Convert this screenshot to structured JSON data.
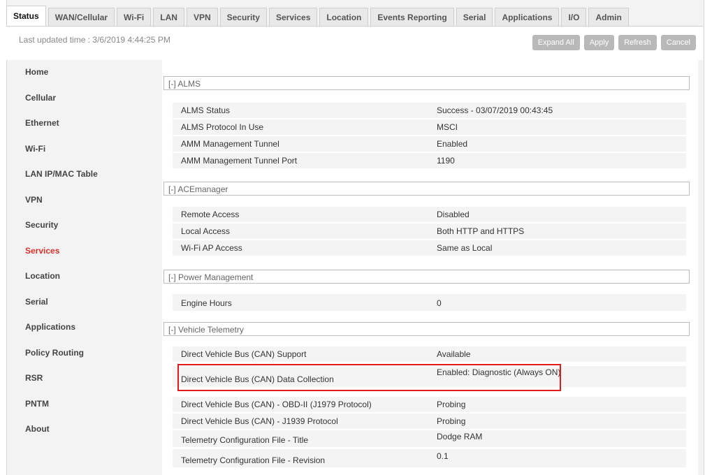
{
  "tabs": [
    "Status",
    "WAN/Cellular",
    "Wi-Fi",
    "LAN",
    "VPN",
    "Security",
    "Services",
    "Location",
    "Events Reporting",
    "Serial",
    "Applications",
    "I/O",
    "Admin"
  ],
  "active_tab": "Status",
  "last_updated": "Last updated time : 3/6/2019 4:44:25 PM",
  "buttons": {
    "expand_all": "Expand All",
    "apply": "Apply",
    "refresh": "Refresh",
    "cancel": "Cancel"
  },
  "sidebar": {
    "items": [
      "Home",
      "Cellular",
      "Ethernet",
      "Wi-Fi",
      "LAN IP/MAC Table",
      "VPN",
      "Security",
      "Services",
      "Location",
      "Serial",
      "Applications",
      "Policy Routing",
      "RSR",
      "PNTM",
      "About"
    ],
    "active": "Services"
  },
  "sections": [
    {
      "header": "[-] ALMS",
      "rows": [
        {
          "label": "ALMS Status",
          "value": "Success - 03/07/2019 00:43:45"
        },
        {
          "label": "ALMS Protocol In Use",
          "value": "MSCI"
        },
        {
          "label": "AMM Management Tunnel",
          "value": "Enabled"
        },
        {
          "label": "AMM Management Tunnel Port",
          "value": "1190"
        }
      ]
    },
    {
      "header": "[-] ACEmanager",
      "rows": [
        {
          "label": "Remote Access",
          "value": "Disabled"
        },
        {
          "label": "Local Access",
          "value": "Both HTTP and HTTPS"
        },
        {
          "label": "Wi-Fi AP Access",
          "value": "Same as Local"
        }
      ]
    },
    {
      "header": "[-] Power Management",
      "rows": [
        {
          "label": "Engine Hours",
          "value": "0"
        }
      ]
    },
    {
      "header": "[-] Vehicle Telemetry",
      "rows": [
        {
          "label": "Direct Vehicle Bus (CAN) Support",
          "value": "Available"
        },
        {
          "label": "Direct Vehicle Bus (CAN) Data Collection",
          "value": "Enabled: Diagnostic (Always ON)"
        },
        {
          "label": "Direct Vehicle Bus (CAN) - OBD-II (J1979 Protocol)",
          "value": "Probing"
        },
        {
          "label": "Direct Vehicle Bus (CAN) - J1939 Protocol",
          "value": "Probing"
        },
        {
          "label": "Telemetry Configuration File - Title",
          "value": "Dodge RAM"
        },
        {
          "label": "Telemetry Configuration File - Revision",
          "value": "0.1"
        }
      ]
    }
  ]
}
